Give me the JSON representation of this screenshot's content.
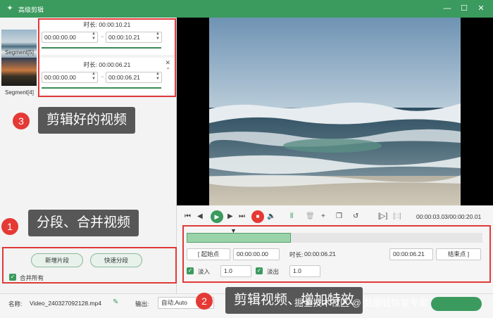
{
  "app": {
    "title": "高级剪辑"
  },
  "segments": [
    {
      "label": "Segment[5]",
      "duration_label": "时长:",
      "duration": "00:00:10.21",
      "start": "00:00:00.00",
      "end": "00:00:10.21"
    },
    {
      "label": "Segment[4]",
      "duration_label": "时长:",
      "duration": "00:00:06.21",
      "start": "00:00:00.00",
      "end": "00:00:06.21"
    }
  ],
  "callouts": {
    "c1": {
      "num": "1",
      "text": "分段、合并视频"
    },
    "c2": {
      "num": "2",
      "text": "剪辑视频、增加特效"
    },
    "c3": {
      "num": "3",
      "text": "剪辑好的视频"
    }
  },
  "left_actions": {
    "new_segment": "新增片段",
    "quick_split": "快速分段",
    "merge_all": "合并所有"
  },
  "playback": {
    "time": "00:00:03.03/00:00:20.01"
  },
  "trim": {
    "start_button": "起始点",
    "start_value": "00:00:00.00",
    "duration_label": "时长:",
    "duration_value": "00:00:06.21",
    "end_value": "00:00:06.21",
    "end_button": "结束点",
    "fade_in_label": "淡入",
    "fade_in_value": "1.0",
    "fade_out_label": "淡出",
    "fade_out_value": "1.0"
  },
  "status": {
    "name_label": "名称:",
    "file_name": "Video_240327092128.mp4",
    "output_label": "输出:",
    "output_value": "自动,Auto"
  },
  "watermark": "掘金技术社区 @ 数据蛙恢复专家",
  "colors": {
    "accent": "#3b9a5e",
    "callout_red": "#e03a3a"
  }
}
